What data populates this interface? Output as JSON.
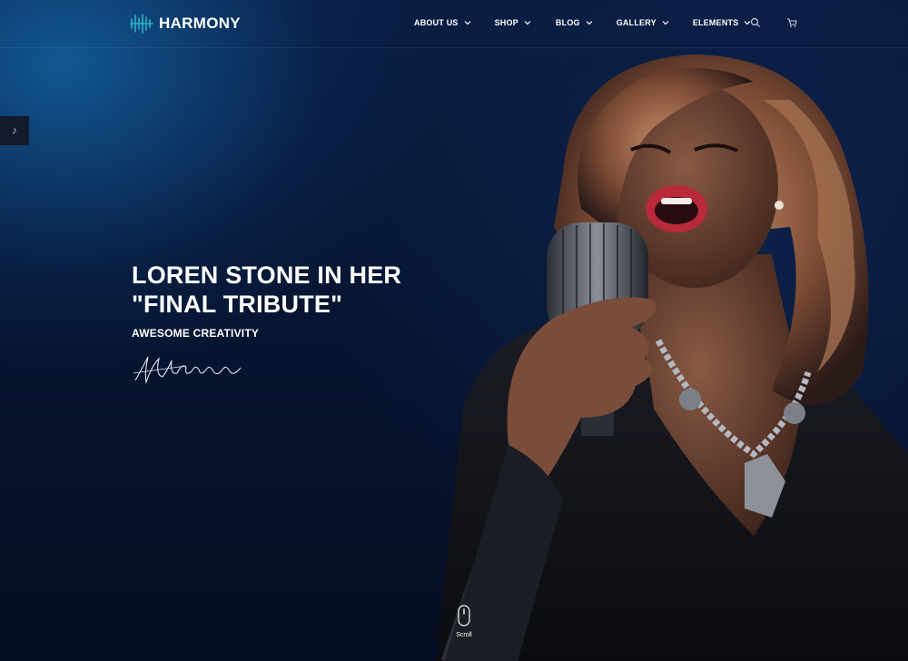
{
  "brand": {
    "name": "HARMONY",
    "icon": "waveform-logo-icon",
    "accent": "#29b6c8"
  },
  "nav": {
    "items": [
      {
        "label": "ABOUT US",
        "has_dropdown": true
      },
      {
        "label": "SHOP",
        "has_dropdown": true
      },
      {
        "label": "BLOG",
        "has_dropdown": true
      },
      {
        "label": "GALLERY",
        "has_dropdown": true
      },
      {
        "label": "ELEMENTS",
        "has_dropdown": true
      }
    ],
    "search_icon": "search-icon",
    "cart_icon": "cart-icon"
  },
  "side_tab": {
    "glyph": "♪",
    "icon": "music-note-icon"
  },
  "hero": {
    "title_line1": "LOREN STONE IN HER",
    "title_line2": "\"FINAL TRIBUTE\"",
    "subtitle": "AWESOME CREATIVITY",
    "signature_icon": "signature-icon"
  },
  "scroll": {
    "label": "Scroll",
    "icon": "mouse-scroll-icon"
  },
  "colors": {
    "background": "#07122b",
    "glow": "#1362a0",
    "text": "#ffffff"
  }
}
